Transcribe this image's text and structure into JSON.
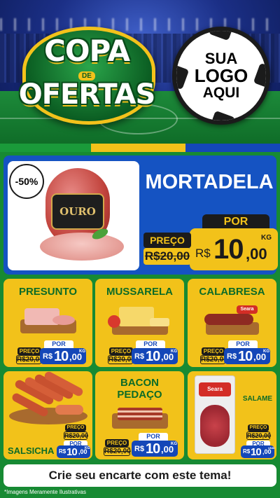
{
  "header": {
    "campaign_line1": "COPA",
    "campaign_de": "DE",
    "campaign_line2": "OFERTAS",
    "logo_placeholder": {
      "line1": "SUA",
      "line2": "LOGO",
      "line3": "AQUI"
    }
  },
  "colors": {
    "green": "#178a33",
    "yellow": "#f2c21a",
    "blue": "#1447b8",
    "dark": "#1b1b1b"
  },
  "featured": {
    "discount": "-50%",
    "brand": "OURO",
    "name": "MORTADELA",
    "old_label": "PREÇO",
    "old_price": "R$20,00",
    "new_label": "POR",
    "currency": "R$",
    "price_int": "10",
    "price_dec": ",00",
    "unit": "KG"
  },
  "products": [
    {
      "name": "PRESUNTO",
      "old_label": "PREÇO",
      "old_price": "R$20,00",
      "new_label": "POR",
      "currency": "R$",
      "price_int": "10",
      "price_dec": ",00",
      "unit": "KG"
    },
    {
      "name": "MUSSARELA",
      "old_label": "PREÇO",
      "old_price": "R$20,00",
      "new_label": "POR",
      "currency": "R$",
      "price_int": "10",
      "price_dec": ",00",
      "unit": "KG"
    },
    {
      "name": "CALABRESA",
      "brand": "Seara",
      "old_label": "PREÇO",
      "old_price": "R$20,00",
      "new_label": "POR",
      "currency": "R$",
      "price_int": "10",
      "price_dec": ",00",
      "unit": "KG"
    },
    {
      "name": "SALSICHA",
      "old_label": "PREÇO",
      "old_price": "R$20,00",
      "new_label": "POR",
      "currency": "R$",
      "price_int": "10",
      "price_dec": ",00",
      "unit": "KG"
    },
    {
      "name_line1": "BACON",
      "name_line2": "PEDAÇO",
      "old_label": "PREÇO",
      "old_price": "R$20,00",
      "new_label": "POR",
      "currency": "R$",
      "price_int": "10",
      "price_dec": ",00",
      "unit": "KG"
    },
    {
      "name": "SALAME",
      "brand": "Seara",
      "old_label": "PREÇO",
      "old_price": "R$20,00",
      "new_label": "POR",
      "currency": "R$",
      "price_int": "10",
      "price_dec": ",00",
      "unit": "UNID"
    }
  ],
  "footer": {
    "cta": "Crie seu encarte com este tema!",
    "disclaimer": "*Imagens Meramente Ilustrativas"
  }
}
